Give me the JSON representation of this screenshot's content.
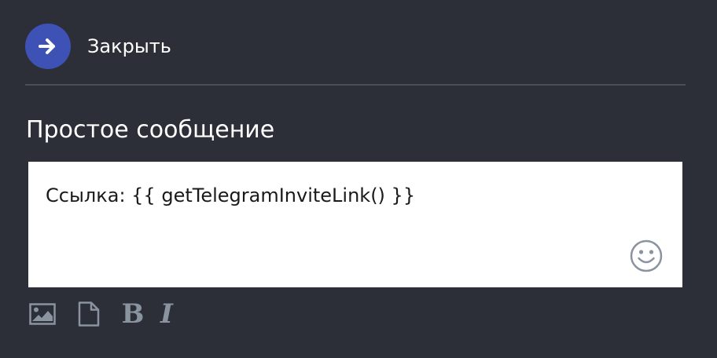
{
  "header": {
    "close_icon": "arrow-right-icon",
    "close_label": "Закрыть"
  },
  "section": {
    "title": "Простое сообщение"
  },
  "editor": {
    "value": "Ссылка: {{ getTelegramInviteLink() }}",
    "emoji_icon": "smiley-icon"
  },
  "toolbar": {
    "image_icon": "image-icon",
    "file_icon": "file-icon",
    "bold_label": "B",
    "italic_label": "I"
  },
  "colors": {
    "background": "#2c2f38",
    "accent": "#3e51b5",
    "divider": "#4a4e59",
    "icon_gray": "#8a94a0",
    "editor_bg": "#ffffff"
  }
}
